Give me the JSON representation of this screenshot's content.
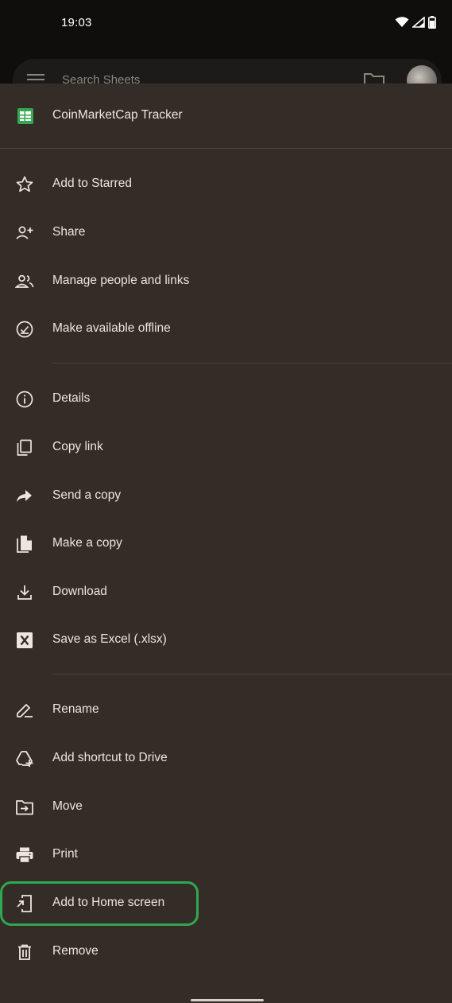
{
  "status_bar": {
    "time": "19:03",
    "icons": [
      "wifi-icon",
      "signal-icon",
      "battery-icon"
    ]
  },
  "app_bar": {
    "search_placeholder": "Search Sheets"
  },
  "file": {
    "title": "CoinMarketCap Tracker",
    "icon": "sheets-file-icon",
    "icon_color": "#34a853"
  },
  "menu": {
    "items": [
      {
        "label": "Add to Starred",
        "icon": "star-icon"
      },
      {
        "label": "Share",
        "icon": "person-add-icon"
      },
      {
        "label": "Manage people and links",
        "icon": "people-icon"
      },
      {
        "label": "Make available offline",
        "icon": "offline-check-icon"
      },
      {
        "label": "Details",
        "icon": "info-icon"
      },
      {
        "label": "Copy link",
        "icon": "copy-icon"
      },
      {
        "label": "Send a copy",
        "icon": "send-arrow-icon"
      },
      {
        "label": "Make a copy",
        "icon": "file-copy-icon"
      },
      {
        "label": "Download",
        "icon": "download-icon"
      },
      {
        "label": "Save as Excel (.xlsx)",
        "icon": "excel-x-icon"
      },
      {
        "label": "Rename",
        "icon": "pencil-icon"
      },
      {
        "label": "Add shortcut to Drive",
        "icon": "drive-shortcut-icon"
      },
      {
        "label": "Move",
        "icon": "folder-move-icon"
      },
      {
        "label": "Print",
        "icon": "print-icon"
      },
      {
        "label": "Add to Home screen",
        "icon": "add-home-screen-icon"
      },
      {
        "label": "Remove",
        "icon": "trash-icon"
      }
    ]
  },
  "colors": {
    "sheet_bg": "#332c27",
    "text": "#ece6df",
    "highlight": "#2fa84f"
  }
}
